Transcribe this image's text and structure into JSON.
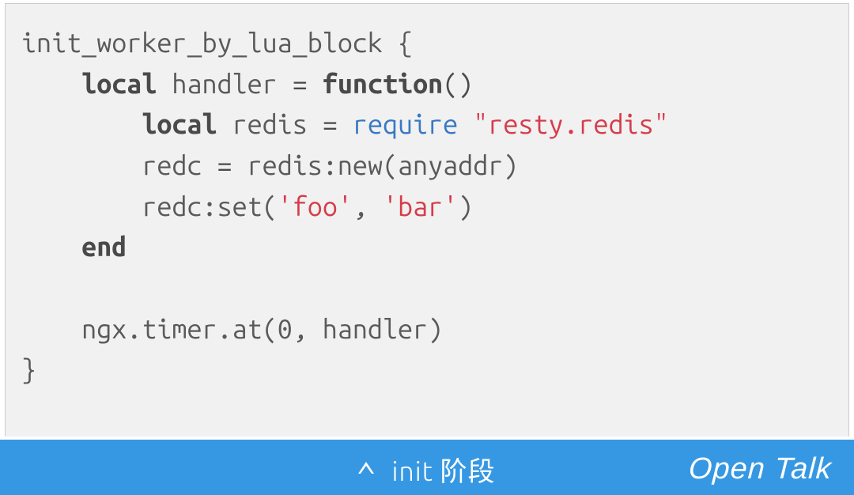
{
  "code": {
    "lines": [
      {
        "indent": 0,
        "spans": [
          {
            "t": "init_worker_by_lua_block {",
            "c": ""
          }
        ]
      },
      {
        "indent": 1,
        "spans": [
          {
            "t": "local",
            "c": "kw"
          },
          {
            "t": " handler ",
            "c": ""
          },
          {
            "t": "=",
            "c": "dark"
          },
          {
            "t": " ",
            "c": ""
          },
          {
            "t": "function",
            "c": "kw"
          },
          {
            "t": "()",
            "c": "dark"
          }
        ]
      },
      {
        "indent": 2,
        "spans": [
          {
            "t": "local",
            "c": "kw"
          },
          {
            "t": " redis ",
            "c": ""
          },
          {
            "t": "=",
            "c": "dark"
          },
          {
            "t": " ",
            "c": ""
          },
          {
            "t": "require",
            "c": "fn"
          },
          {
            "t": " ",
            "c": ""
          },
          {
            "t": "\"resty.redis\"",
            "c": "str"
          }
        ]
      },
      {
        "indent": 2,
        "spans": [
          {
            "t": "redc ",
            "c": ""
          },
          {
            "t": "=",
            "c": "dark"
          },
          {
            "t": " redis:new(anyaddr)",
            "c": ""
          }
        ]
      },
      {
        "indent": 2,
        "spans": [
          {
            "t": "redc:set(",
            "c": ""
          },
          {
            "t": "'foo'",
            "c": "str"
          },
          {
            "t": ", ",
            "c": ""
          },
          {
            "t": "'bar'",
            "c": "str"
          },
          {
            "t": ")",
            "c": ""
          }
        ]
      },
      {
        "indent": 1,
        "spans": [
          {
            "t": "end",
            "c": "kw"
          }
        ]
      },
      {
        "indent": 0,
        "spans": [
          {
            "t": "",
            "c": ""
          }
        ]
      },
      {
        "indent": 1,
        "spans": [
          {
            "t": "ngx.timer.at(0, handler)",
            "c": ""
          }
        ]
      },
      {
        "indent": 0,
        "spans": [
          {
            "t": "}",
            "c": ""
          }
        ]
      }
    ]
  },
  "footer": {
    "caption": "init 阶段",
    "brand": "Open Talk"
  }
}
